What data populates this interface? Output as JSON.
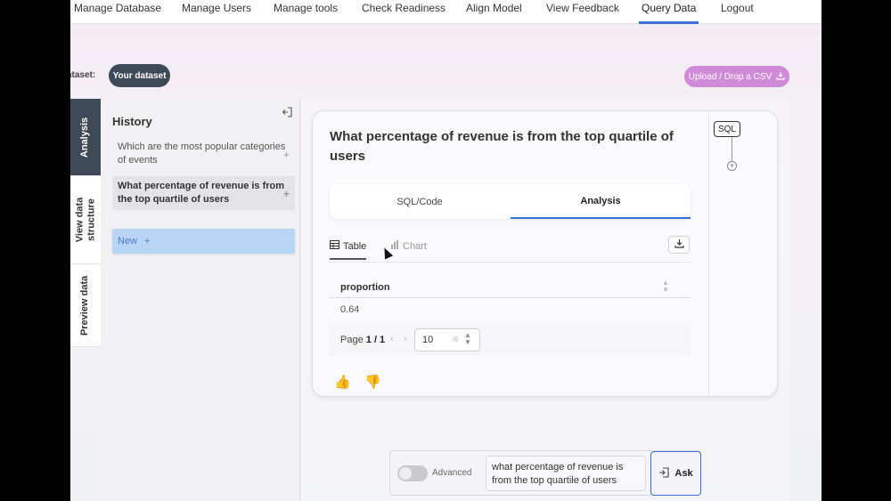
{
  "nav": {
    "items": [
      {
        "label": "Manage Database"
      },
      {
        "label": "Manage Users"
      },
      {
        "label": "Manage tools"
      },
      {
        "label": "Check Readiness"
      },
      {
        "label": "Align Model"
      },
      {
        "label": "View Feedback"
      },
      {
        "label": "Query Data"
      },
      {
        "label": "Logout"
      }
    ],
    "active": "Query Data"
  },
  "dataset": {
    "label": "ataset:",
    "chip": "Your dataset",
    "upload_label": "Upload / Drop a CSV",
    "upload_icon": "download-icon"
  },
  "vertical_tabs": {
    "analysis": "Analysis",
    "structure_line1": "View data",
    "structure_line2": "structure",
    "preview": "Preview data"
  },
  "history": {
    "title": "History",
    "items": [
      {
        "text": "Which are the most popular categories of events"
      },
      {
        "text": "What percentage of revenue is from the top quartile of users"
      }
    ],
    "new_label": "New",
    "plus": "+"
  },
  "main": {
    "question": "What percentage of revenue is from the top quartile of users",
    "tabs": [
      {
        "label": "SQL/Code"
      },
      {
        "label": "Analysis"
      }
    ],
    "active_tab": "Analysis",
    "subtabs": [
      {
        "label": "Table",
        "icon": "table-icon"
      },
      {
        "label": "Chart",
        "icon": "bar-chart-icon"
      }
    ],
    "table": {
      "columns": [
        "proportion"
      ],
      "rows": [
        [
          "0.64"
        ]
      ]
    },
    "pagination": {
      "page_word": "Page",
      "current": "1 / 1",
      "page_size": "10"
    },
    "sql_badge": "SQL"
  },
  "ask": {
    "advanced_label": "Advanced",
    "input_value": "what percentage of revenue is from the top quartile of users",
    "button_label": "Ask"
  },
  "colors": {
    "accent": "#3b6ed8",
    "dark_chip": "#3f4a59",
    "upload": "#cf8ad8",
    "new_button": "#b9d5f5"
  }
}
